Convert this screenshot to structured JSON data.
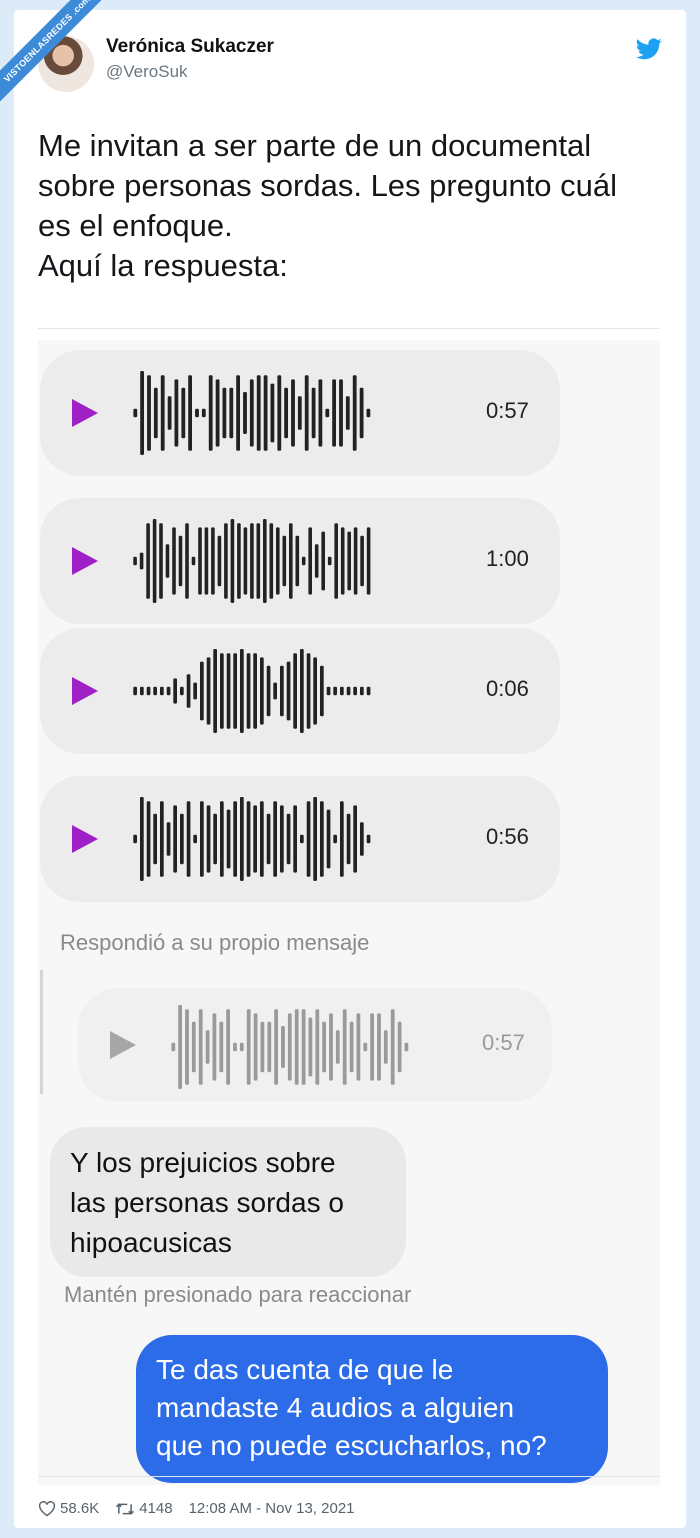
{
  "watermark": {
    "text": "VISTOENLASREDES .com"
  },
  "tweet": {
    "author_name": "Verónica Sukaczer",
    "author_handle": "@VeroSuk",
    "text": "Me invitan a ser parte de un documental\nsobre personas sordas. Les pregunto cuál\nes el enfoque.\nAquí la respuesta:",
    "likes": "58.6K",
    "retweets": "4148",
    "timestamp": "12:08 AM - Nov 13, 2021"
  },
  "conversation": {
    "audios": [
      {
        "duration": "0:57",
        "icon": "play-icon"
      },
      {
        "duration": "1:00",
        "icon": "play-icon"
      },
      {
        "duration": "0:06",
        "icon": "play-icon"
      },
      {
        "duration": "0:56",
        "icon": "play-icon"
      }
    ],
    "reply_note": "Respondió a su propio mensaje",
    "quoted_audio": {
      "duration": "0:57"
    },
    "received_message": "Y los prejuicios sobre\nlas personas sordas o\nhipoacusicas",
    "hold_hint": "Mantén presionado para reaccionar",
    "sent_message": "Te das cuenta de que le\nmandaste 4 audios a alguien\nque no puede escucharlos, no?"
  },
  "colors": {
    "twitter_blue": "#1da1f2",
    "play_purple": "#a020c8",
    "sent_bubble": "#2d6ce8",
    "waveform": "#222222",
    "waveform_faded": "#9a9a9a"
  }
}
